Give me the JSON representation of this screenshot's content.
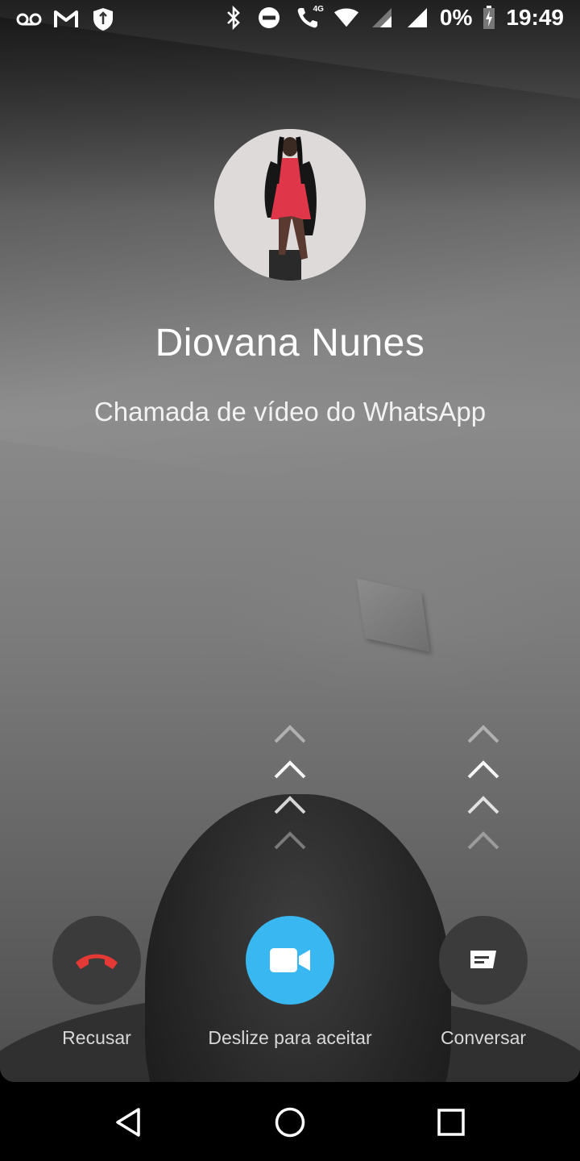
{
  "status_bar": {
    "battery_percent": "0%",
    "time": "19:49",
    "network_label": "4G",
    "left_icons": [
      "voicemail-icon",
      "gmail-icon",
      "shield-icon"
    ],
    "right_icons": [
      "bluetooth-icon",
      "do-not-disturb-icon",
      "wifi-calling-icon",
      "wifi-icon",
      "signal-icon",
      "signal-icon",
      "battery-charging-icon"
    ]
  },
  "call": {
    "caller_name": "Diovana Nunes",
    "call_type": "Chamada de vídeo do WhatsApp"
  },
  "actions": {
    "decline_label": "Recusar",
    "accept_label": "Deslize para aceitar",
    "chat_label": "Conversar",
    "decline_color": "#e53935",
    "accept_color": "#38b7f0"
  },
  "navigation": {
    "back": "back-icon",
    "home": "home-icon",
    "recents": "recents-icon"
  }
}
